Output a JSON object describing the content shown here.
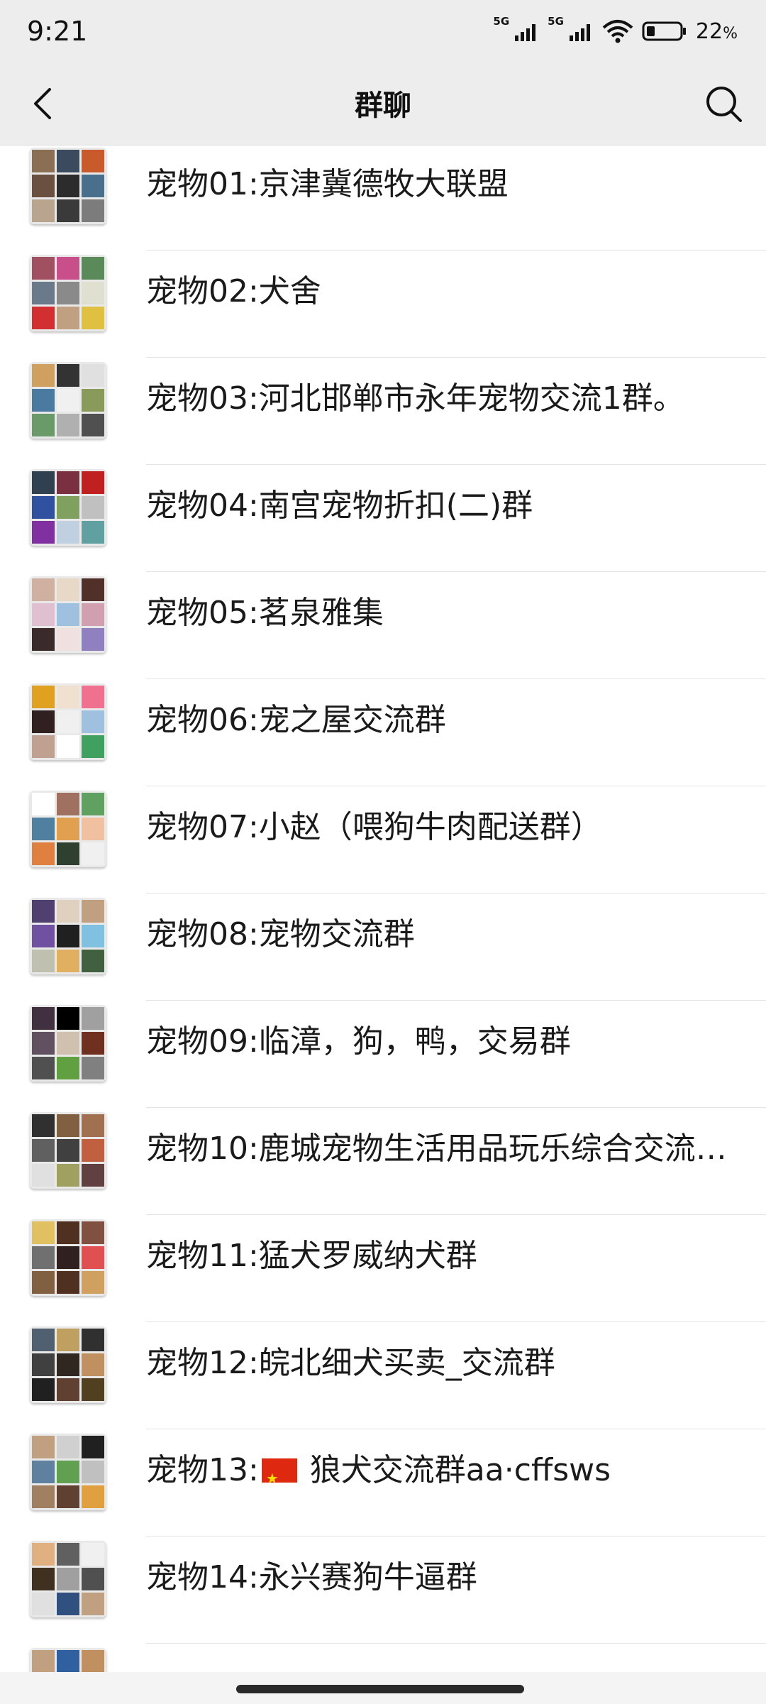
{
  "status_bar": {
    "time": "9:21",
    "network1": "5G",
    "network2": "5G",
    "battery_percent": "22",
    "battery_unit": "%"
  },
  "header": {
    "title": "群聊",
    "back_icon": "chevron-left-icon",
    "search_icon": "search-icon"
  },
  "groups": [
    {
      "name": "宠物01:京津冀德牧大联盟",
      "colors": [
        "#8a6f55",
        "#3b4a5e",
        "#c85a2c",
        "#6a5040",
        "#2c2c2c",
        "#4a6f8c",
        "#b9a58f",
        "#3a3a3a",
        "#7c7c7c"
      ]
    },
    {
      "name": "宠物02:犬舍",
      "colors": [
        "#a05060",
        "#c94f8a",
        "#5a8a5a",
        "#6a7a8a",
        "#8a8a8a",
        "#e0e0d0",
        "#d23030",
        "#c0a080",
        "#e0c040"
      ]
    },
    {
      "name": "宠物03:河北邯郸市永年宠物交流1群。",
      "colors": [
        "#d0a060",
        "#333333",
        "#e0e0e0",
        "#4a7aa0",
        "#f0f0f0",
        "#8a9a5a",
        "#6a9a6a",
        "#b0b0b0",
        "#505050"
      ]
    },
    {
      "name": "宠物04:南宫宠物折扣(二)群",
      "colors": [
        "#304050",
        "#7a3040",
        "#c02020",
        "#3050a0",
        "#80a060",
        "#c0c0c0",
        "#8030a0",
        "#c0d0e0",
        "#60a0a0"
      ]
    },
    {
      "name": "宠物05:茗泉雅集",
      "colors": [
        "#d0b0a0",
        "#e8d8c8",
        "#503028",
        "#e0c0d0",
        "#a0c0e0",
        "#d0a0b0",
        "#3a2a2a",
        "#f0e0e0",
        "#9080c0"
      ]
    },
    {
      "name": "宠物06:宠之屋交流群",
      "colors": [
        "#e0a020",
        "#f0e0d0",
        "#f07090",
        "#302020",
        "#f0f0f0",
        "#a0c0e0",
        "#c0a090",
        "#ffffff",
        "#40a060"
      ]
    },
    {
      "name": "宠物07:小赵（喂狗牛肉配送群）",
      "colors": [
        "#ffffff",
        "#a07060",
        "#60a060",
        "#5080a0",
        "#e0a050",
        "#f0c0a0",
        "#e08040",
        "#304030",
        "#f0f0f0"
      ]
    },
    {
      "name": "宠物08:宠物交流群",
      "colors": [
        "#504070",
        "#e0d0c0",
        "#c0a080",
        "#7050a0",
        "#202020",
        "#80c0e0",
        "#c0c0b0",
        "#e0b060",
        "#406040"
      ]
    },
    {
      "name": "宠物09:临漳，狗，鸭，交易群",
      "colors": [
        "#403040",
        "#000000",
        "#a0a0a0",
        "#605060",
        "#d0c0b0",
        "#703020",
        "#505050",
        "#60a040",
        "#808080"
      ]
    },
    {
      "name": "宠物10:鹿城宠物生活用品玩乐综合交流…",
      "colors": [
        "#303030",
        "#806040",
        "#a07050",
        "#606060",
        "#404040",
        "#c06040",
        "#e0e0e0",
        "#a0a060",
        "#604040"
      ]
    },
    {
      "name": "宠物11:猛犬罗威纳犬群",
      "colors": [
        "#e0c060",
        "#503020",
        "#805040",
        "#707070",
        "#302020",
        "#e05050",
        "#806040",
        "#503020",
        "#d0a060"
      ]
    },
    {
      "name": "宠物12:皖北细犬买卖_交流群",
      "colors": [
        "#506070",
        "#c0a060",
        "#303030",
        "#404040",
        "#302820",
        "#c09060",
        "#202020",
        "#604030",
        "#504020"
      ]
    },
    {
      "name": "宠物13:",
      "name_tail": " 狼犬交流群aa·cffsws",
      "colors": [
        "#c0a080",
        "#d0d0d0",
        "#202020",
        "#6080a0",
        "#60a050",
        "#c0c0c0",
        "#a08060",
        "#604030",
        "#e0a040"
      ]
    },
    {
      "name": "宠物14:永兴赛狗牛逼群",
      "colors": [
        "#e0b080",
        "#606060",
        "#f0f0f0",
        "#403020",
        "#a0a0a0",
        "#505050",
        "#e0e0e0",
        "#305080",
        "#c0a080"
      ]
    },
    {
      "name": "",
      "colors": [
        "#c0a080",
        "#3060a0",
        "#c09060",
        "#d0d0d0",
        "#808080",
        "#a0a0a0",
        "#c0c0c0",
        "#e0e0e0",
        "#909090"
      ]
    }
  ],
  "bottom": {
    "home_indicator": "home-indicator"
  }
}
